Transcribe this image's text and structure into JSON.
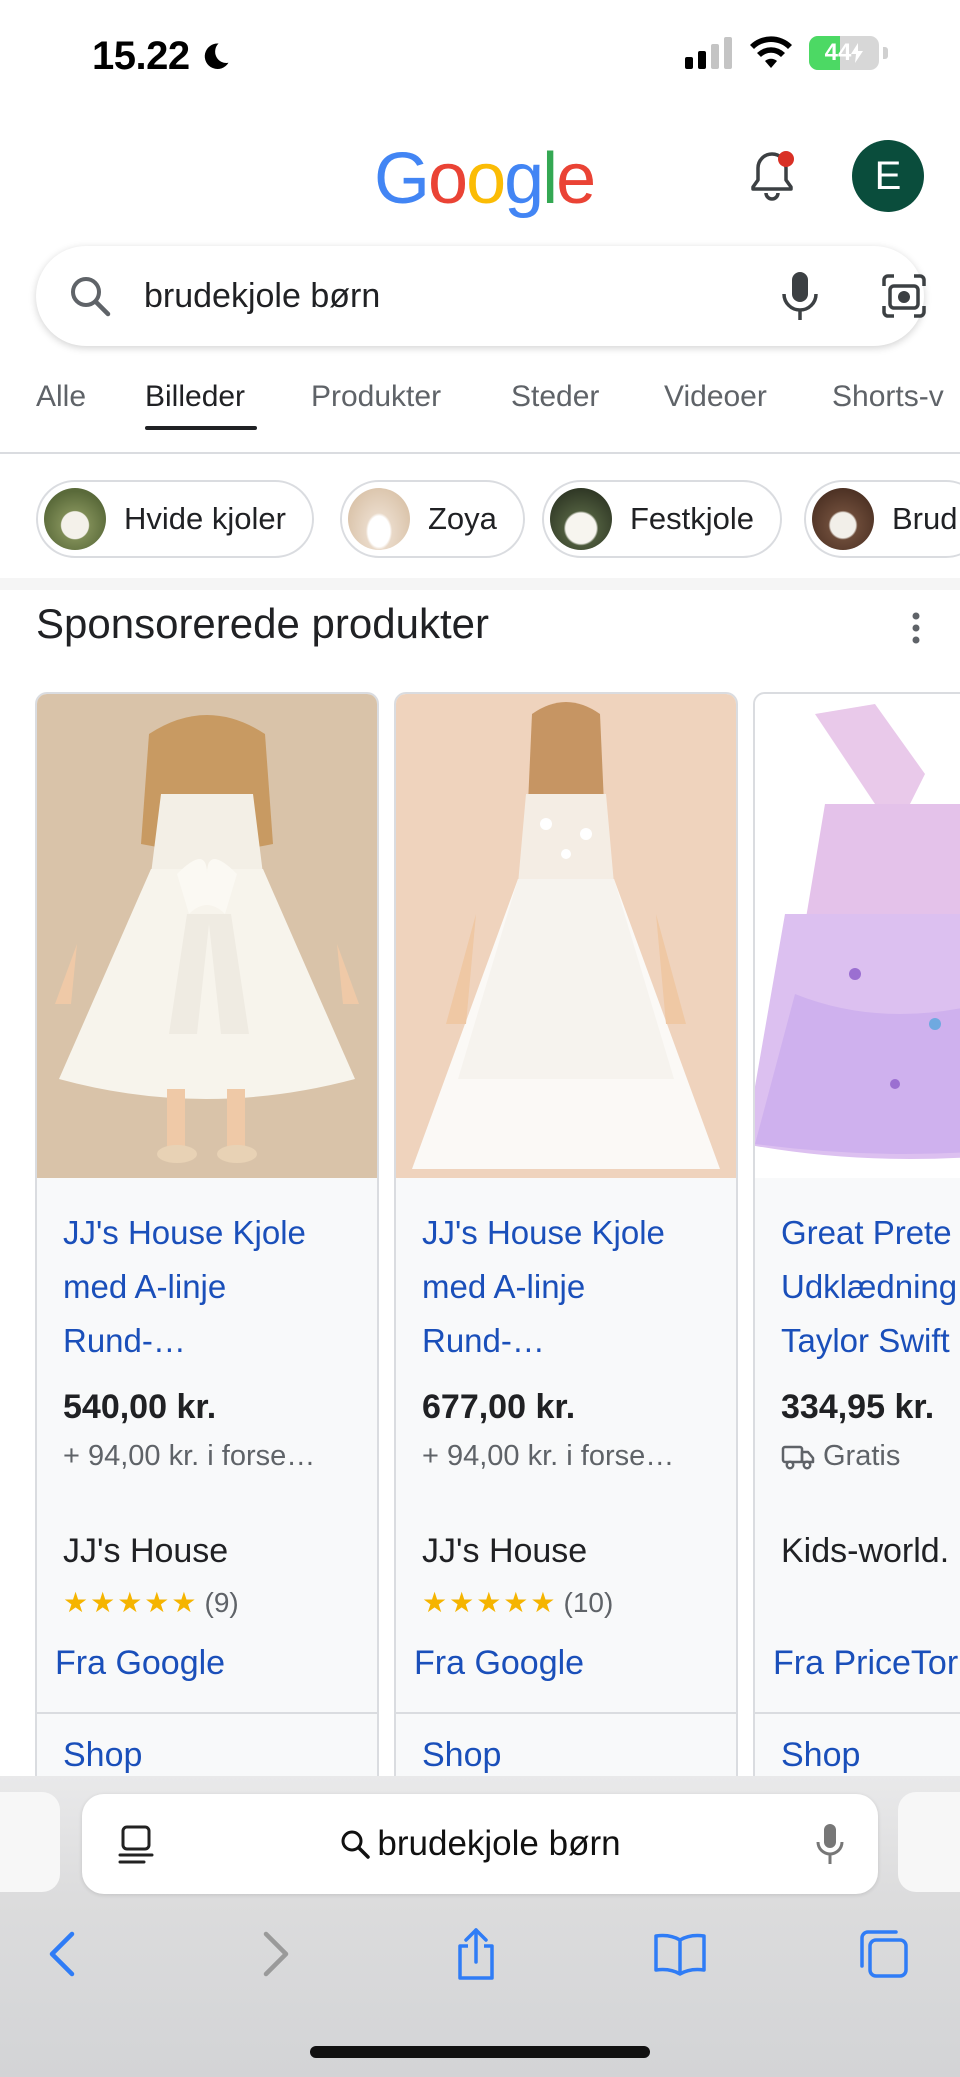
{
  "status_bar": {
    "time": "15.22",
    "battery": "44",
    "battery_level": 0.44
  },
  "header": {
    "logo_letters": [
      {
        "char": "G",
        "color": "#4285F4"
      },
      {
        "char": "o",
        "color": "#EA4335"
      },
      {
        "char": "o",
        "color": "#FBBC05"
      },
      {
        "char": "g",
        "color": "#4285F4"
      },
      {
        "char": "l",
        "color": "#34A853"
      },
      {
        "char": "e",
        "color": "#EA4335"
      }
    ],
    "avatar_letter": "E"
  },
  "search": {
    "query": "brudekjole børn"
  },
  "tabs": [
    {
      "label": "Alle",
      "active": false
    },
    {
      "label": "Billeder",
      "active": true
    },
    {
      "label": "Produkter",
      "active": false
    },
    {
      "label": "Steder",
      "active": false
    },
    {
      "label": "Videoer",
      "active": false
    },
    {
      "label": "Shorts-v",
      "active": false
    }
  ],
  "chips": [
    {
      "label": "Hvide kjoler"
    },
    {
      "label": "Zoya"
    },
    {
      "label": "Festkjole"
    },
    {
      "label": "Brud"
    }
  ],
  "section": {
    "title": "Sponsorerede produkter"
  },
  "products": [
    {
      "title_lines": [
        "JJ's House Kjole",
        "med A-linje",
        "Rund-…"
      ],
      "price": "540,00 kr.",
      "shipping": "+ 94,00 kr. i forse…",
      "store": "JJ's House",
      "stars": "★★★★★",
      "rating_count": "(9)",
      "source": "Fra Google",
      "shop": "Shop"
    },
    {
      "title_lines": [
        "JJ's House Kjole",
        "med A-linje",
        "Rund-…"
      ],
      "price": "677,00 kr.",
      "shipping": "+ 94,00 kr. i forse…",
      "store": "JJ's House",
      "stars": "★★★★★",
      "rating_count": "(10)",
      "source": "Fra Google",
      "shop": "Shop"
    },
    {
      "title_lines": [
        "Great Prete",
        "Udklædning",
        "Taylor Swift"
      ],
      "price": "334,95 kr.",
      "shipping": "Gratis",
      "store": "Kids-world.",
      "stars": "",
      "rating_count": "",
      "source": "Fra PriceTor",
      "shop": "Shop"
    }
  ],
  "browser": {
    "address_text": "brudekjole børn"
  },
  "colors": {
    "link_blue": "#1a4fba",
    "avatar_bg": "#0a4d3c",
    "star": "#f5b400",
    "notification_dot": "#d93025",
    "ios_blue": "#2f7cf6"
  }
}
